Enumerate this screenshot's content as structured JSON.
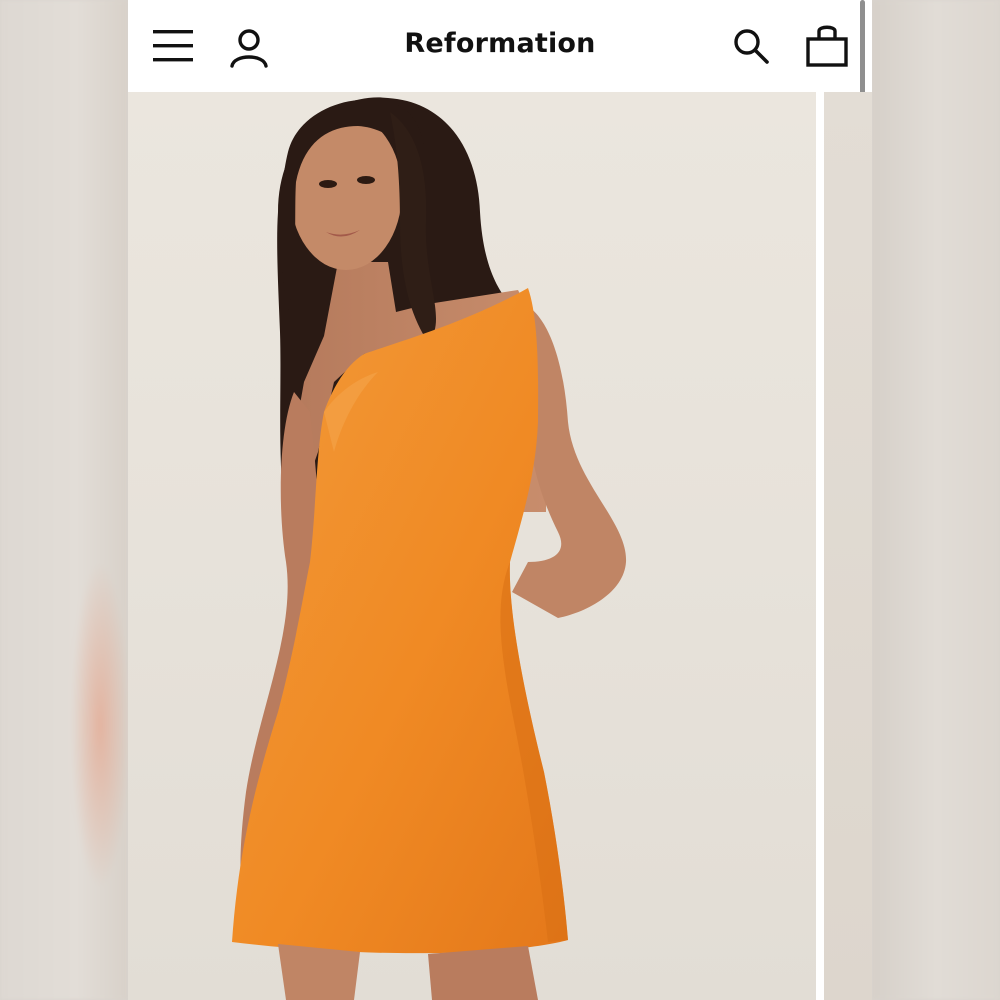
{
  "header": {
    "brand": "Reformation",
    "icons": [
      "menu-icon",
      "account-icon",
      "search-icon",
      "shopping-bag-icon"
    ]
  },
  "product_image": {
    "subject": "model-wearing-orange-sleeveless-mini-dress",
    "dress_color": "#f08a24",
    "background_color": "#e8e3db"
  },
  "colors": {
    "header_bg": "#ffffff",
    "icon": "#111111"
  }
}
